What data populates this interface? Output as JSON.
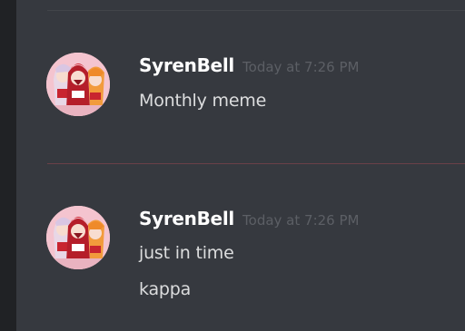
{
  "messages": [
    {
      "username": "SyrenBell",
      "timestamp": "Today at 7:26 PM",
      "lines": [
        "Monthly meme"
      ]
    },
    {
      "username": "SyrenBell",
      "timestamp": "Today at 7:26 PM",
      "lines": [
        "just in time",
        "kappa"
      ]
    }
  ],
  "colors": {
    "background": "#36393f",
    "username": "#ffffff",
    "timestamp": "#5c5f65",
    "message_text": "#dcddde",
    "new_message_divider": "#6b4048"
  }
}
